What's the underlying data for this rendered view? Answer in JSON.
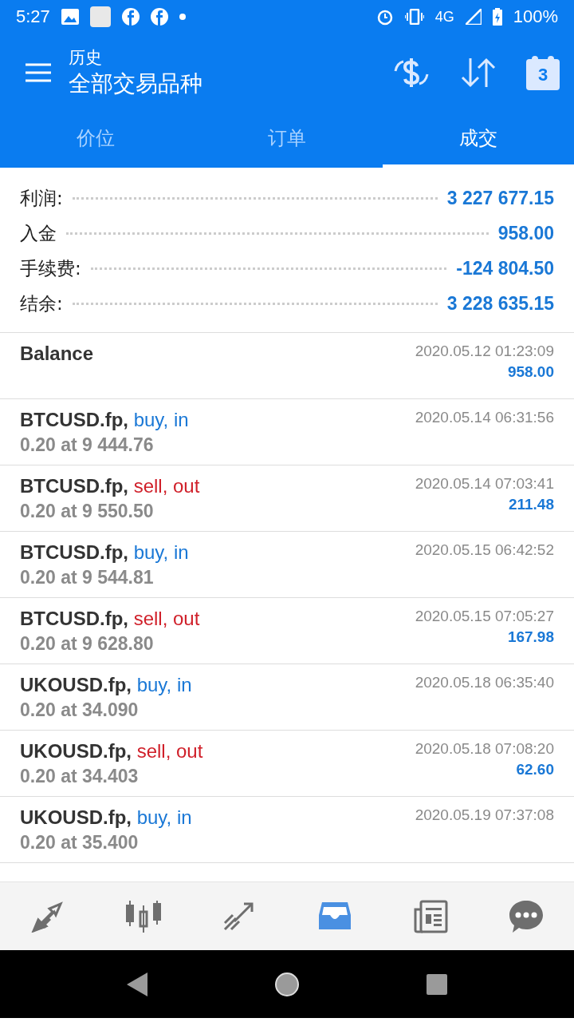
{
  "status_bar": {
    "time": "5:27",
    "network": "4G",
    "battery": "100%"
  },
  "header": {
    "subtitle": "历史",
    "title": "全部交易品种",
    "calendar_day": "3"
  },
  "tabs": [
    {
      "label": "价位",
      "selected": false
    },
    {
      "label": "订单",
      "selected": false
    },
    {
      "label": "成交",
      "selected": true
    }
  ],
  "summary": [
    {
      "label": "利润:",
      "value": "3 227 677.15"
    },
    {
      "label": "入金",
      "value": "958.00"
    },
    {
      "label": "手续费:",
      "value": "-124 804.50"
    },
    {
      "label": "结余:",
      "value": "3 228 635.15"
    }
  ],
  "deals": [
    {
      "kind": "balance",
      "title": "Balance",
      "time": "2020.05.12 01:23:09",
      "profit": "958.00"
    },
    {
      "kind": "trade",
      "symbol": "BTCUSD.fp,",
      "direction": {
        "text": "buy, in",
        "color": "#1a78d6"
      },
      "detail": "0.20 at 9 444.76",
      "time": "2020.05.14 06:31:56"
    },
    {
      "kind": "trade",
      "symbol": "BTCUSD.fp,",
      "direction": {
        "text": "sell, out",
        "color": "#d0202a"
      },
      "detail": "0.20 at 9 550.50",
      "time": "2020.05.14 07:03:41",
      "profit": "211.48"
    },
    {
      "kind": "trade",
      "symbol": "BTCUSD.fp,",
      "direction": {
        "text": "buy, in",
        "color": "#1a78d6"
      },
      "detail": "0.20 at 9 544.81",
      "time": "2020.05.15 06:42:52"
    },
    {
      "kind": "trade",
      "symbol": "BTCUSD.fp,",
      "direction": {
        "text": "sell, out",
        "color": "#d0202a"
      },
      "detail": "0.20 at 9 628.80",
      "time": "2020.05.15 07:05:27",
      "profit": "167.98"
    },
    {
      "kind": "trade",
      "symbol": "UKOUSD.fp,",
      "direction": {
        "text": "buy, in",
        "color": "#1a78d6"
      },
      "detail": "0.20 at 34.090",
      "time": "2020.05.18 06:35:40"
    },
    {
      "kind": "trade",
      "symbol": "UKOUSD.fp,",
      "direction": {
        "text": "sell, out",
        "color": "#d0202a"
      },
      "detail": "0.20 at 34.403",
      "time": "2020.05.18 07:08:20",
      "profit": "62.60"
    },
    {
      "kind": "trade",
      "symbol": "UKOUSD.fp,",
      "direction": {
        "text": "buy, in",
        "color": "#1a78d6"
      },
      "detail": "0.20 at 35.400",
      "time": "2020.05.19 07:37:08"
    }
  ],
  "bottom_nav": [
    {
      "kind": "quotes",
      "selected": false
    },
    {
      "kind": "chart",
      "selected": false
    },
    {
      "kind": "trade",
      "selected": false
    },
    {
      "kind": "history",
      "selected": true
    },
    {
      "kind": "news",
      "selected": false
    },
    {
      "kind": "chat",
      "selected": false
    }
  ]
}
